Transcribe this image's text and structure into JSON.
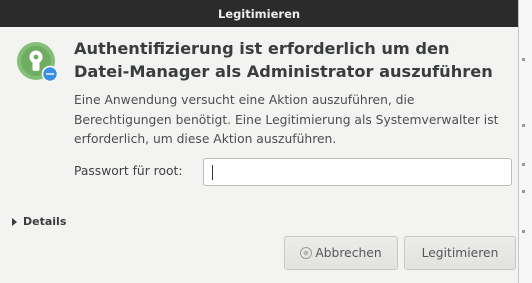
{
  "dialog": {
    "title": "Legitimieren",
    "heading": "Authentifizierung ist erforderlich um den Datei-Manager als Administrator auszuführen",
    "description": "Eine Anwendung versucht eine Aktion auszuführen, die Berechtigungen benötigt. Eine Legitimierung als Systemverwalter ist erforderlich, um diese Aktion auszuführen.",
    "password_label": "Passwort für root:",
    "password_value": "",
    "details_label": "Details",
    "cancel_label": "Abbrechen",
    "authenticate_label": "Legitimieren"
  },
  "icons": {
    "auth": "padlock-keyhole-icon",
    "expander": "triangle-right-icon",
    "cancel": "radio-icon"
  },
  "colors": {
    "titlebar": "#2b2b2b",
    "window_bg": "#f3f3f2",
    "icon_green": "#7cb96f",
    "icon_blue": "#3a8ee6"
  }
}
